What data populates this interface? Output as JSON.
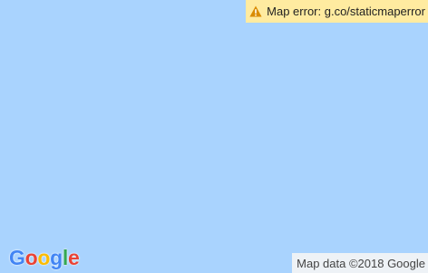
{
  "map": {
    "background_color": "#a9d3fe",
    "error": {
      "icon": "warning-icon",
      "text": "Map error: g.co/staticmaperror",
      "background_color": "#ffeba0"
    },
    "logo": {
      "letters": [
        "G",
        "o",
        "o",
        "g",
        "l",
        "e"
      ],
      "colors": [
        "#4285f4",
        "#ea4335",
        "#fbbc05",
        "#4285f4",
        "#34a853",
        "#ea4335"
      ]
    },
    "attribution": "Map data ©2018 Google"
  }
}
